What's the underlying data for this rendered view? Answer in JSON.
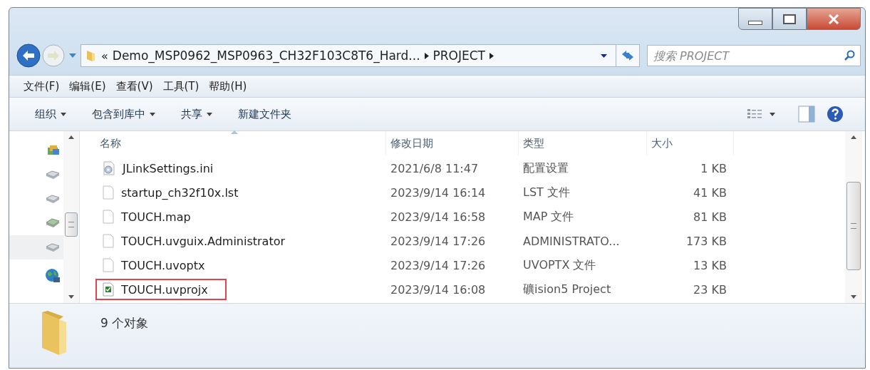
{
  "address": {
    "overflow": "«",
    "crumbs": [
      "Demo_MSP0962_MSP0963_CH32F103C8T6_Hard...",
      "PROJECT"
    ]
  },
  "search": {
    "placeholder": "搜索 PROJECT"
  },
  "menu": [
    "文件(F)",
    "编辑(E)",
    "查看(V)",
    "工具(T)",
    "帮助(H)"
  ],
  "commands": [
    {
      "label": "组织",
      "dropdown": true
    },
    {
      "label": "包含到库中",
      "dropdown": true
    },
    {
      "label": "共享",
      "dropdown": true
    },
    {
      "label": "新建文件夹",
      "dropdown": false
    }
  ],
  "nav": [
    {
      "kind": "library"
    },
    {
      "kind": "drive"
    },
    {
      "kind": "drive"
    },
    {
      "kind": "disc"
    },
    {
      "kind": "drive",
      "selected": true
    },
    {
      "kind": "network"
    }
  ],
  "columns": [
    "名称",
    "修改日期",
    "类型",
    "大小"
  ],
  "files": [
    {
      "name": "JLinkSettings.ini",
      "date": "2021/6/8 11:47",
      "type": "配置设置",
      "size": "1 KB",
      "kind": "settings",
      "highlighted": false
    },
    {
      "name": "startup_ch32f10x.lst",
      "date": "2023/9/14 16:14",
      "type": "LST 文件",
      "size": "41 KB",
      "kind": "blank",
      "highlighted": false
    },
    {
      "name": "TOUCH.map",
      "date": "2023/9/14 16:58",
      "type": "MAP 文件",
      "size": "81 KB",
      "kind": "blank",
      "highlighted": false
    },
    {
      "name": "TOUCH.uvguix.Administrator",
      "date": "2023/9/14 17:26",
      "type": "ADMINISTRATO...",
      "size": "173 KB",
      "kind": "blank",
      "highlighted": false
    },
    {
      "name": "TOUCH.uvoptx",
      "date": "2023/9/14 17:26",
      "type": "UVOPTX 文件",
      "size": "13 KB",
      "kind": "blank",
      "highlighted": false
    },
    {
      "name": "TOUCH.uvprojx",
      "date": "2023/9/14 16:08",
      "type": "礦ision5 Project",
      "size": "23 KB",
      "kind": "project",
      "highlighted": true
    }
  ],
  "status": "9 个对象"
}
